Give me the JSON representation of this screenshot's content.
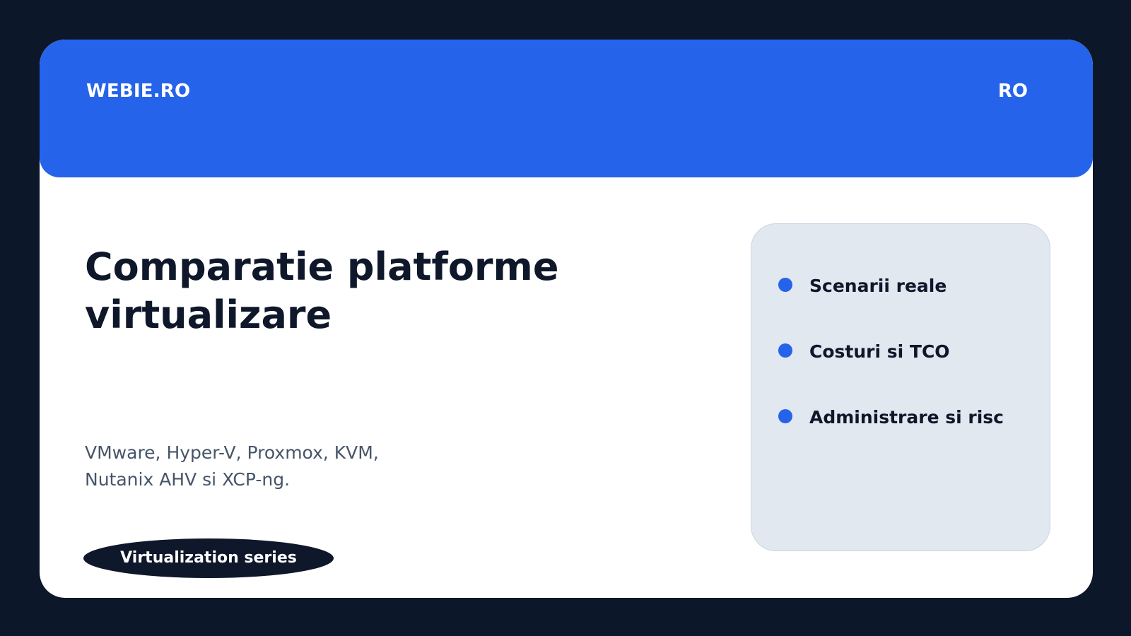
{
  "header": {
    "brand": "WEBIE.RO",
    "language": "RO"
  },
  "main": {
    "title": "Comparatie platforme virtualizare",
    "subtitle": "VMware, Hyper-V, Proxmox, KVM, Nutanix AHV si XCP-ng.",
    "tag": "Virtualization series"
  },
  "panel": {
    "items": [
      {
        "label": "Scenarii reale"
      },
      {
        "label": "Costuri si TCO"
      },
      {
        "label": "Administrare si risc"
      }
    ]
  },
  "colors": {
    "page_background": "#0d172a",
    "accent": "#2563eb",
    "card": "#ffffff",
    "panel": "#e2e8f0",
    "title_text": "#0f172a",
    "subtitle_text": "#475569"
  }
}
